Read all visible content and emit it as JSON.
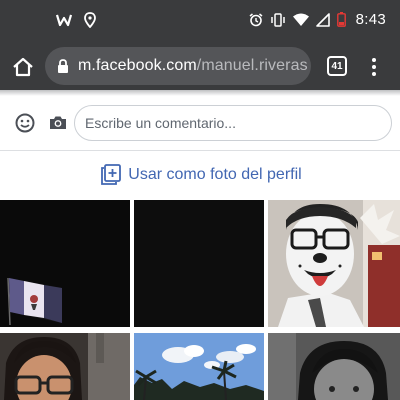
{
  "status_bar": {
    "time": "8:43",
    "left_icons": [
      "w-app-icon",
      "location-pin-icon"
    ],
    "right_icons": [
      "alarm-icon",
      "vibrate-icon",
      "wifi-icon",
      "signal-icon",
      "battery-low-icon"
    ],
    "battery_color": "#e53935"
  },
  "browser": {
    "url_host": "m.facebook.com",
    "url_path": "/manuel.riveras",
    "tab_count": "41"
  },
  "comment_bar": {
    "placeholder": "Escribe un comentario..."
  },
  "profile_action": {
    "label": "Usar como foto del perfil",
    "color": "#4267b2"
  },
  "photos": {
    "items": [
      {
        "subject": "dark-photo-with-flag"
      },
      {
        "subject": "dark-photo"
      },
      {
        "subject": "person-with-dog-face-paint"
      },
      {
        "subject": "person-with-glasses"
      },
      {
        "subject": "sky-with-palm-trees"
      },
      {
        "subject": "person-grayscale"
      }
    ]
  }
}
